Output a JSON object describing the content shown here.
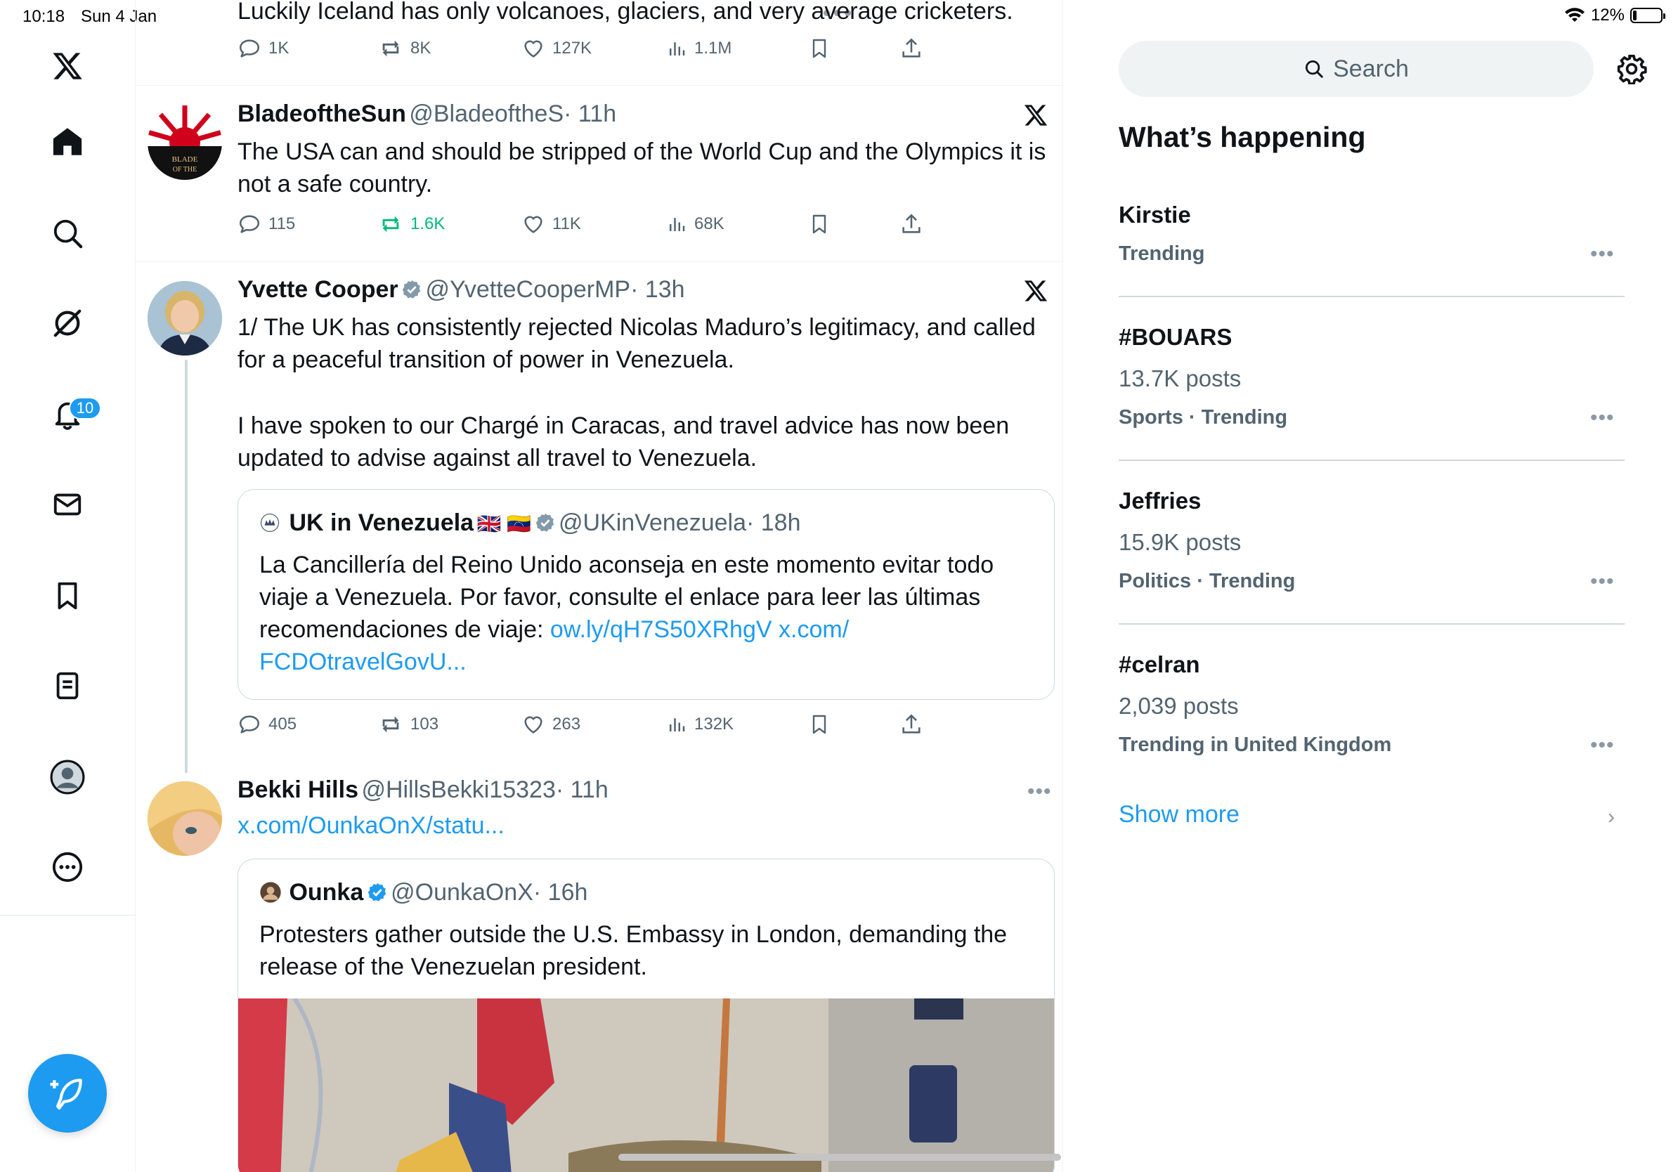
{
  "status_bar": {
    "time": "10:18",
    "date": "Sun 4 Jan",
    "battery": "12%"
  },
  "nav": {
    "notifications_badge": "10"
  },
  "tweet0": {
    "text": "Luckily Iceland has only volcanoes, glaciers, and very average cricketers.",
    "replies": "1K",
    "reposts": "8K",
    "likes": "127K",
    "views": "1.1M"
  },
  "tweet1": {
    "name": "BladeoftheSun",
    "handle": "@BladeoftheS",
    "time": "· 11h",
    "text": "The USA can and should be stripped of the World Cup and the Olympics it is not a safe country.",
    "avatar_text": "BLADE OF THE SUN",
    "replies": "115",
    "reposts": "1.6K",
    "likes": "11K",
    "views": "68K"
  },
  "tweet2": {
    "name": "Yvette Cooper",
    "handle": "@YvetteCooperMP",
    "time": "· 13h",
    "text1": "1/ The UK has consistently rejected Nicolas Maduro’s legitimacy, and called for a peaceful transition of power in Venezuela.",
    "text2": "I have spoken to our Chargé in Caracas, and travel advice has now been updated to advise against all travel to Venezuela.",
    "quote": {
      "name": "UK in Venezuela",
      "flags": "🇬🇧 🇻🇪",
      "handle": "@UKinVenezuela",
      "time": "· 18h",
      "text": "La Cancillería del Reino Unido aconseja en este momento evitar todo viaje a Venezuela. Por favor, consulte el enlace para leer las últimas recomendaciones de viaje:",
      "link1": "ow.ly/qH7S50XRhgV",
      "link2": "x.com/",
      "link3": "FCDOtravelGovU..."
    },
    "replies": "405",
    "reposts": "103",
    "likes": "263",
    "views": "132K"
  },
  "tweet3": {
    "name": "Bekki Hills",
    "handle": "@HillsBekki15323",
    "time": "· 11h",
    "link": "x.com/OunkaOnX/statu...",
    "quote": {
      "name": "Ounka",
      "handle": "@OunkaOnX",
      "time": "· 16h",
      "text": "Protesters gather outside the U.S. Embassy in London, demanding the release of the Venezuelan president."
    }
  },
  "right": {
    "search_placeholder": "Search",
    "title": "What’s happening",
    "trends": [
      {
        "name": "Kirstie",
        "count": "",
        "context": "Trending"
      },
      {
        "name": "#BOUARS",
        "count": "13.7K posts",
        "context": "Sports · Trending"
      },
      {
        "name": "Jeffries",
        "count": "15.9K posts",
        "context": "Politics · Trending"
      },
      {
        "name": "#celran",
        "count": "2,039 posts",
        "context": "Trending in United Kingdom"
      }
    ],
    "show_more": "Show more"
  },
  "colors": {
    "accent": "#1d9bf0",
    "repost_active": "#00ba7c",
    "secondary_text": "#536471"
  }
}
